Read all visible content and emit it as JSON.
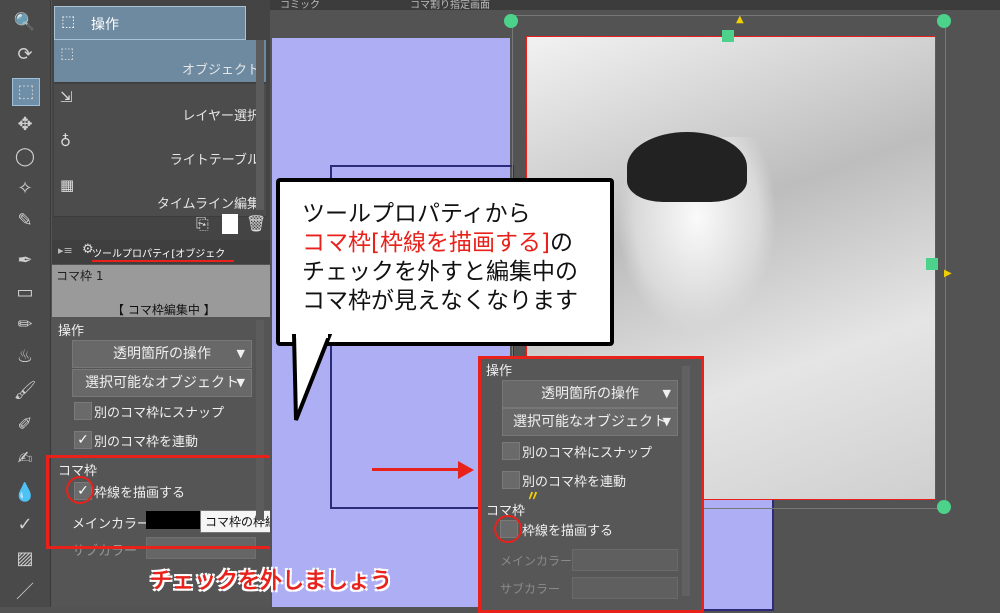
{
  "canvas_tabs": [
    "コミック",
    "コマ割り指定画面"
  ],
  "subtool": {
    "header": "操作",
    "items": [
      {
        "label": "オブジェクト",
        "icon": "cursor-object-icon"
      },
      {
        "label": "レイヤー選択",
        "icon": "layer-select-icon"
      },
      {
        "label": "ライトテーブル",
        "icon": "lightbulb-icon"
      },
      {
        "label": "タイムライン編集",
        "icon": "timeline-icon"
      }
    ]
  },
  "tool_property": {
    "tab_label": "ツールプロパティ[オブジェク",
    "frame_name": "コマ枠 1",
    "frame_status": "【 コマ枠編集中 】",
    "section_operation": "操作",
    "transparent_op": "透明箇所の操作",
    "selectable_obj": "選択可能なオブジェクト",
    "snap_label": "別のコマ枠にスナップ",
    "link_label": "別のコマ枠を連動",
    "link_checked": "✓",
    "section_frame": "コマ枠",
    "draw_border_label": "枠線を描画する",
    "draw_border_checked": "✓",
    "main_color_label": "メインカラー",
    "main_color_value": "#000000",
    "sub_color_label": "サブカラー",
    "tooltip": "コマ枠の枠線を描画します"
  },
  "callout": {
    "line1": "ツールプロパティから",
    "line2_red": "コマ枠[枠線を描画する]",
    "line2_rest": "の",
    "line3": "チェックを外すと編集中の",
    "line4": "コマ枠が見えなくなります"
  },
  "popup": {
    "section_operation": "操作",
    "transparent_op": "透明箇所の操作",
    "selectable_obj": "選択可能なオブジェクト",
    "snap_label": "別のコマ枠にスナップ",
    "link_label": "別のコマ枠を連動",
    "section_frame": "コマ枠",
    "draw_border_label": "枠線を描画する",
    "main_color_label": "メインカラー",
    "sub_color_label": "サブカラー"
  },
  "caption": "チェックを外しましょう",
  "colors": {
    "accent_red": "#e8221b",
    "panel_blue": "#aeaef5",
    "selected": "#6d8aa0"
  }
}
